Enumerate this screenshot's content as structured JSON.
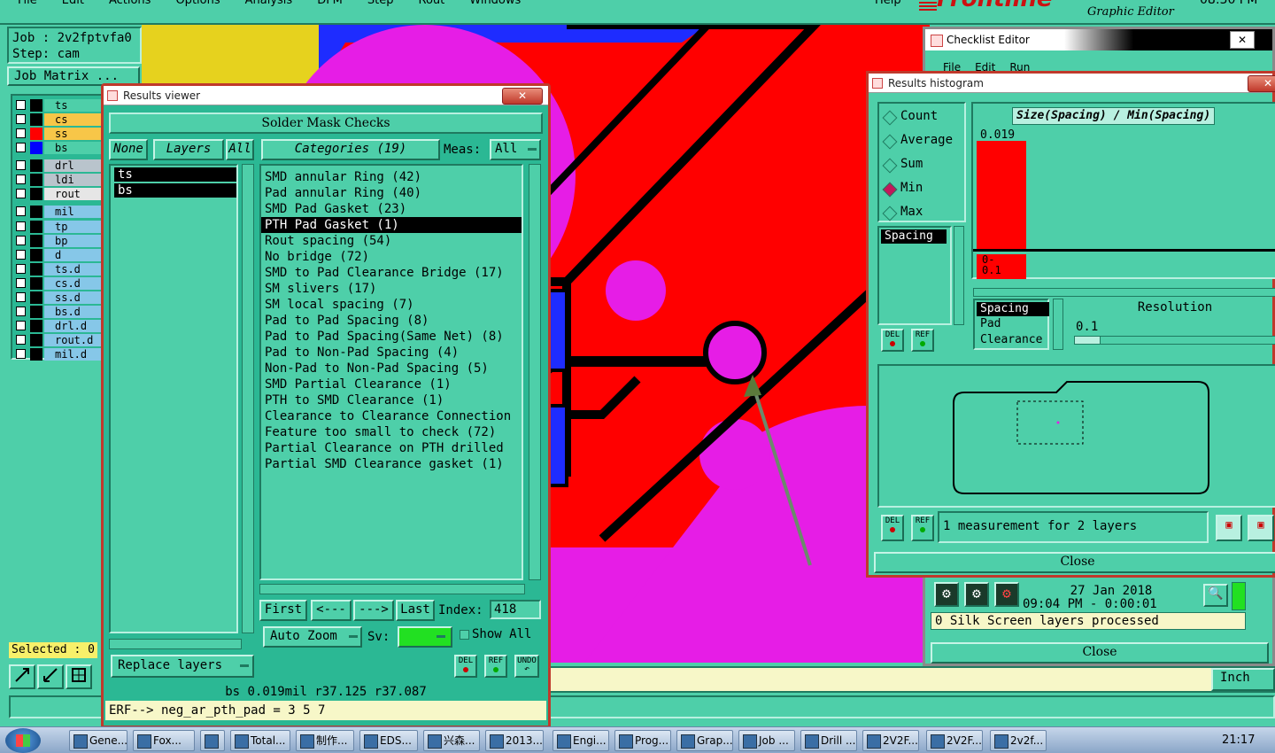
{
  "menubar": {
    "items": [
      "File",
      "Edit",
      "Actions",
      "Options",
      "Analysis",
      "DFM",
      "Step",
      "Rout",
      "Windows"
    ],
    "help": "Help",
    "brand": "Frontline",
    "brand_sub": "Graphic Editor",
    "clock": "08:30 PM"
  },
  "job_panel": {
    "job": "Job : 2v2fptvfa0",
    "step": "Step: cam",
    "job_matrix": "Job Matrix ...",
    "selected": "Selected : 0",
    "units": "Inch"
  },
  "layers": [
    {
      "name": "ts",
      "color": "#4ecfa9",
      "mark": ""
    },
    {
      "name": "cs",
      "color": "#f7c648",
      "mark": ""
    },
    {
      "name": "ss",
      "color": "#f7c648",
      "mark": "#ff0000"
    },
    {
      "name": "bs",
      "color": "#4ecfa9",
      "mark": "#0000ff"
    },
    {
      "name": "drl",
      "color": "#b9c4cc",
      "mark": ""
    },
    {
      "name": "ldi",
      "color": "#b9c4cc",
      "mark": ""
    },
    {
      "name": "rout",
      "color": "#e6e6e6",
      "mark": ""
    },
    {
      "name": "mil",
      "color": "#86c7e8",
      "mark": ""
    },
    {
      "name": "tp",
      "color": "#86c7e8",
      "mark": ""
    },
    {
      "name": "bp",
      "color": "#86c7e8",
      "mark": ""
    },
    {
      "name": "d",
      "color": "#86c7e8",
      "mark": ""
    },
    {
      "name": "ts.d",
      "color": "#86c7e8",
      "mark": ""
    },
    {
      "name": "cs.d",
      "color": "#86c7e8",
      "mark": ""
    },
    {
      "name": "ss.d",
      "color": "#86c7e8",
      "mark": ""
    },
    {
      "name": "bs.d",
      "color": "#86c7e8",
      "mark": ""
    },
    {
      "name": "drl.d",
      "color": "#86c7e8",
      "mark": ""
    },
    {
      "name": "rout.d",
      "color": "#86c7e8",
      "mark": ""
    },
    {
      "name": "mil.d",
      "color": "#86c7e8",
      "mark": ""
    }
  ],
  "results_viewer": {
    "title": "Results viewer",
    "header": "Solder Mask Checks",
    "none_btn": "None",
    "layers_btn": "Layers",
    "all_btn": "All",
    "categories_btn": "Categories (19)",
    "meas_label": "Meas:",
    "meas_value": "All",
    "layer_list": [
      "ts",
      "bs"
    ],
    "categories": [
      "SMD annular Ring (42)",
      "Pad annular Ring (40)",
      "SMD Pad Gasket (23)",
      "PTH Pad Gasket (1)",
      "Rout spacing (54)",
      "No bridge (72)",
      "SMD to Pad Clearance Bridge (17)",
      "SM slivers (17)",
      "SM local spacing (7)",
      "Pad to Pad Spacing (8)",
      "Pad to Pad Spacing(Same Net) (8)",
      "Pad to Non-Pad Spacing (4)",
      "Non-Pad to Non-Pad Spacing (5)",
      "SMD Partial Clearance (1)",
      "PTH to SMD Clearance (1)",
      "Clearance to Clearance Connection",
      "Feature too small to check (72)",
      "Partial Clearance on PTH drilled",
      "Partial SMD Clearance gasket (1)"
    ],
    "selected_index": 3,
    "first": "First",
    "prev": "<---",
    "next": "--->",
    "last": "Last",
    "index_label": "Index:",
    "index_value": "418",
    "auto_zoom": "Auto Zoom",
    "sv_label": "Sv:",
    "show_all": "Show All",
    "replace_layers": "Replace layers",
    "del": "DEL",
    "ref": "REF",
    "undo": "UNDO",
    "status": "bs 0.019mil  r37.125  r37.087",
    "erf": "ERF--> neg_ar_pth_pad = 3 5 7"
  },
  "checklist_editor": {
    "title": "Checklist Editor",
    "menu": [
      "File",
      "Edit",
      "Run"
    ],
    "date": "27 Jan 2018",
    "time": "09:04 PM - 0:00:01",
    "message": "0 Silk Screen layers processed",
    "close": "Close"
  },
  "histogram": {
    "title": "Results histogram",
    "modes": [
      "Count",
      "Average",
      "Sum",
      "Min",
      "Max"
    ],
    "mode_selected": "Min",
    "formula": "Size(Spacing) / Min(Spacing)",
    "bar_value": "0.019",
    "bar_range": "0-\n0.1",
    "measure_list": [
      "Spacing"
    ],
    "category_list": [
      "Spacing",
      "Pad",
      "Clearance"
    ],
    "resolution_label": "Resolution",
    "resolution_value": "0.1",
    "status": "1 measurement for 2 layers",
    "close": "Close",
    "del": "DEL",
    "ref": "REF"
  },
  "taskbar": {
    "items": [
      "Gene...",
      "Fox...",
      "",
      "Total...",
      "制作...",
      "EDS...",
      "兴森...",
      "2013...",
      "Engi...",
      "Prog...",
      "Grap...",
      "Job ...",
      "Drill ...",
      "2V2F...",
      "2V2F...",
      "2v2f..."
    ],
    "clock": "21:17"
  }
}
